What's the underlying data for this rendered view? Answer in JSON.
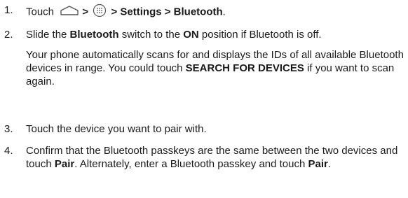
{
  "steps": [
    {
      "num": "1.",
      "touch": "Touch",
      "sep1": ">",
      "home_icon": "home-icon",
      "apps_icon": "apps-grid-icon",
      "path": "> Settings > Bluetooth",
      "path_end": "."
    },
    {
      "num": "2.",
      "p1_a": "Slide the ",
      "p1_b": "Bluetooth",
      "p1_c": " switch to the ",
      "p1_d": "ON",
      "p1_e": " position if Bluetooth is off.",
      "p2_a": "Your phone automatically scans for and displays the IDs of all available Bluetooth devices in range. You could touch ",
      "p2_b": "SEARCH FOR DEVICES",
      "p2_c": " if you want to scan again."
    },
    {
      "num": "3.",
      "text": "Touch the device you want to pair with."
    },
    {
      "num": "4.",
      "a": "Confirm that the Bluetooth passkeys are the same between the two devices and touch ",
      "b": "Pair",
      "c": ". Alternately, enter a Bluetooth passkey and touch ",
      "d": "Pair",
      "e": "."
    }
  ]
}
